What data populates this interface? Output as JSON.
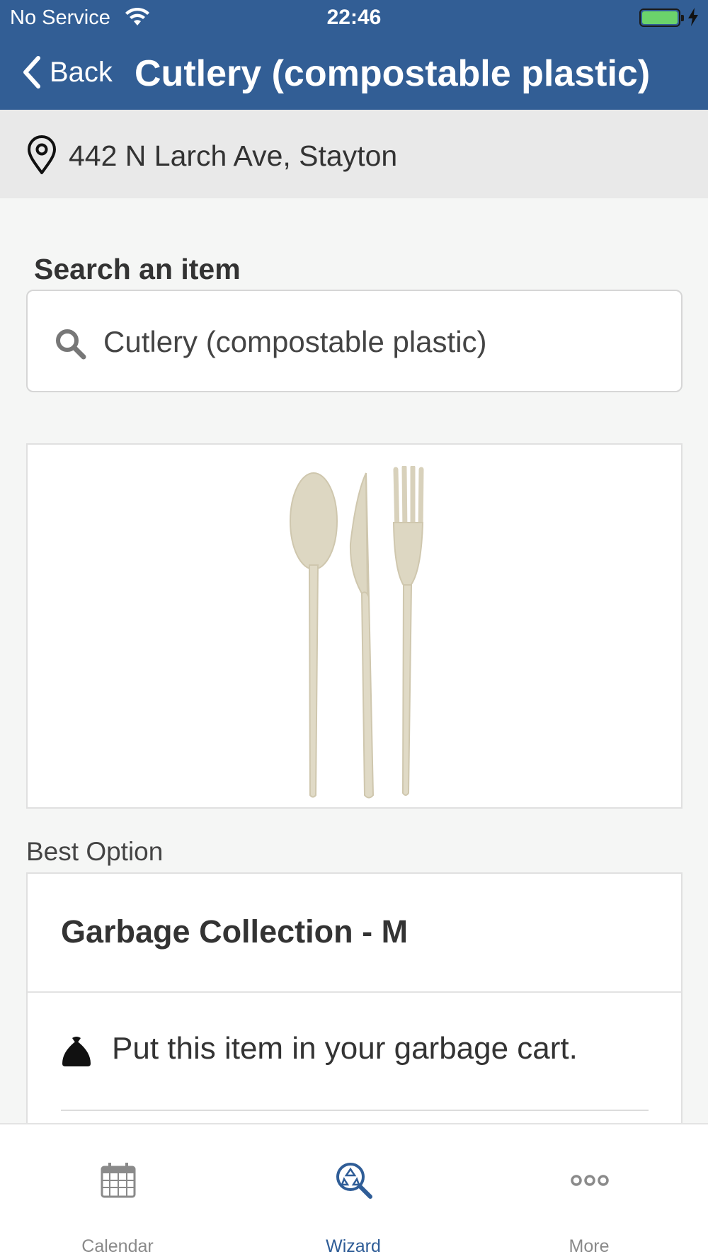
{
  "status_bar": {
    "carrier": "No Service",
    "time": "22:46",
    "icons": [
      "wifi-icon",
      "battery-icon",
      "charging-bolt-icon"
    ]
  },
  "nav": {
    "back_label": "Back",
    "title": "Cutlery (compostable plastic)"
  },
  "address": {
    "icon": "location-pin-icon",
    "text": "442 N Larch Ave, Stayton"
  },
  "search": {
    "label": "Search an item",
    "value": "Cutlery (compostable plastic)",
    "icon": "search-icon"
  },
  "item_image": {
    "subject": "compostable-cutlery-image"
  },
  "best_option": {
    "section_label": "Best Option",
    "title": "Garbage Collection - M",
    "instruction": "Put this item in your garbage cart.",
    "instruction_icon": "garbage-bag-icon"
  },
  "tabs": [
    {
      "label": "Calendar",
      "icon": "calendar-icon",
      "active": false
    },
    {
      "label": "Wizard",
      "icon": "recycle-search-icon",
      "active": true
    },
    {
      "label": "More",
      "icon": "more-dots-icon",
      "active": false
    }
  ],
  "colors": {
    "header": "#325e95",
    "active_tab": "#2f5d97",
    "inactive_tab": "#8a8a8a",
    "battery": "#6bd36b"
  }
}
